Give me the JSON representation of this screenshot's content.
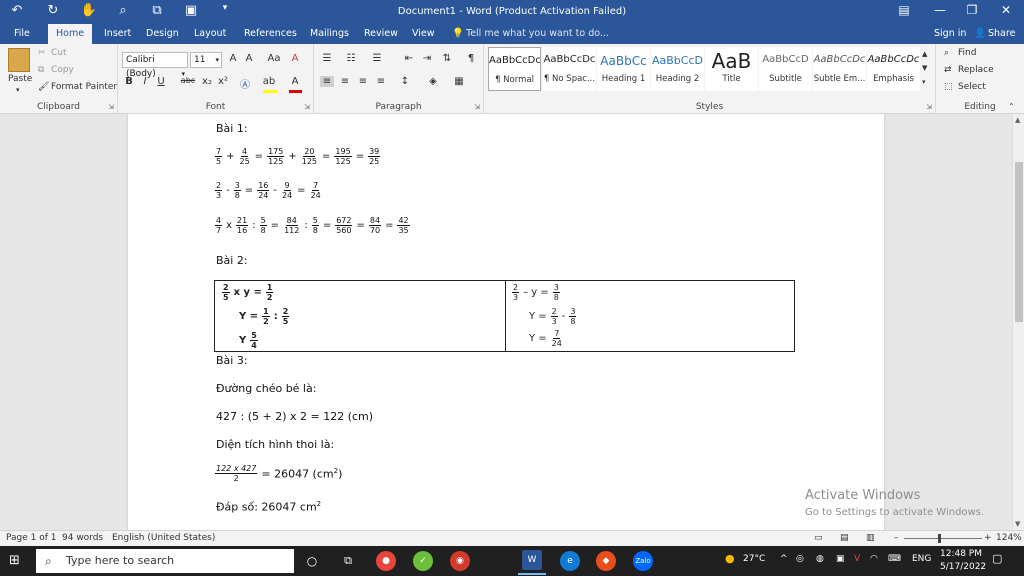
{
  "titlebar": {
    "title": "Document1 - Word (Product Activation Failed)",
    "undo_glyph": "↶",
    "redo_glyph": "↻",
    "save_glyph": "▣",
    "minimize_glyph": "—",
    "restore_glyph": "❐",
    "close_glyph": "✕",
    "ribbon_display_glyph": "▤"
  },
  "tabs": [
    {
      "label": "File"
    },
    {
      "label": "Home"
    },
    {
      "label": "Insert"
    },
    {
      "label": "Design"
    },
    {
      "label": "Layout"
    },
    {
      "label": "References"
    },
    {
      "label": "Mailings"
    },
    {
      "label": "Review"
    },
    {
      "label": "View"
    }
  ],
  "tell_me": "Tell me what you want to do...",
  "signin": "Sign in",
  "share": "Share",
  "clipboard": {
    "paste": "Paste",
    "cut": "Cut",
    "copy": "Copy",
    "format_painter": "Format Painter",
    "label": "Clipboard"
  },
  "font": {
    "name": "Calibri (Body)",
    "size": "11",
    "label": "Font",
    "bold": "B",
    "italic": "I",
    "underline": "U",
    "strike": "abc",
    "subscript": "x₂",
    "superscript": "x²",
    "grow": "A",
    "shrink": "A",
    "case": "Aa",
    "clear": "A"
  },
  "paragraph": {
    "label": "Paragraph",
    "pilcrow": "¶"
  },
  "styles": {
    "label": "Styles",
    "items": [
      {
        "preview": "AaBbCcDc",
        "name": "¶ Normal"
      },
      {
        "preview": "AaBbCcDc",
        "name": "¶ No Spac..."
      },
      {
        "preview": "AaBbCc",
        "name": "Heading 1"
      },
      {
        "preview": "AaBbCcD",
        "name": "Heading 2"
      },
      {
        "preview": "AaB",
        "name": "Title"
      },
      {
        "preview": "AaBbCcD",
        "name": "Subtitle"
      },
      {
        "preview": "AaBbCcDc",
        "name": "Subtle Em..."
      },
      {
        "preview": "AaBbCcDc",
        "name": "Emphasis"
      }
    ]
  },
  "editing": {
    "label": "Editing",
    "find": "Find",
    "replace": "Replace",
    "select": "Select"
  },
  "colors": {
    "accent": "#2b579a",
    "highlight": "#ffff00",
    "font_color": "#e00000"
  },
  "doc": {
    "bai1": "Bài 1:",
    "eq1": {
      "a_n": "7",
      "a_d": "5",
      "op1": "+",
      "b_n": "4",
      "b_d": "25",
      "c_n": "175",
      "c_d": "125",
      "op2": "+",
      "d_n": "20",
      "d_d": "125",
      "e_n": "195",
      "e_d": "125",
      "f_n": "39",
      "f_d": "25"
    },
    "eq2": {
      "a_n": "2",
      "a_d": "3",
      "op1": "-",
      "b_n": "3",
      "b_d": "8",
      "c_n": "16",
      "c_d": "24",
      "op2": "-",
      "d_n": "9",
      "d_d": "24",
      "e_n": "7",
      "e_d": "24"
    },
    "eq3": {
      "a_n": "4",
      "a_d": "7",
      "op1": "x",
      "b_n": "21",
      "b_d": "16",
      "op2": ":",
      "c_n": "5",
      "c_d": "8",
      "d_n": "84",
      "d_d": "112",
      "op3": ":",
      "e_n": "5",
      "e_d": "8",
      "f_n": "672",
      "f_d": "560",
      "g_n": "84",
      "g_d": "70",
      "h_n": "42",
      "h_d": "35"
    },
    "bai2": "Bài 2:",
    "left": {
      "l1": {
        "a_n": "2",
        "a_d": "5",
        "mid": "x y =",
        "b_n": "1",
        "b_d": "2"
      },
      "l2": {
        "pre": "Y =",
        "a_n": "1",
        "a_d": "2",
        "op": ":",
        "b_n": "2",
        "b_d": "5"
      },
      "l3": {
        "pre": "Y",
        "a_n": "5",
        "a_d": "4"
      }
    },
    "right": {
      "r1": {
        "a_n": "2",
        "a_d": "3",
        "mid": "– y =",
        "b_n": "3",
        "b_d": "8"
      },
      "r2": {
        "pre": "Y =",
        "a_n": "2",
        "a_d": "3",
        "op": "-",
        "b_n": "3",
        "b_d": "8"
      },
      "r3": {
        "pre": "Y =",
        "a_n": "7",
        "a_d": "24"
      }
    },
    "bai3": "Bài 3:",
    "duong_cheo": "Đường chéo bé là:",
    "calc1": "427 : (5 + 2) x 2 = 122 (cm)",
    "dien_tich": "Diện tích hình thoi là:",
    "calc2": {
      "num": "122 x 427",
      "den": "2",
      "rest": "= 26047 (cm",
      "sup": "2",
      "close": ")"
    },
    "dap_so": "Đáp số: 26047 cm",
    "dap_so_sup": "2"
  },
  "watermark": {
    "line1": "Activate Windows",
    "line2": "Go to Settings to activate Windows."
  },
  "status": {
    "page": "Page 1 of 1",
    "words": "94 words",
    "lang": "English (United States)",
    "zoom_minus": "–",
    "zoom_plus": "+",
    "zoom": "124%"
  },
  "taskbar": {
    "search": "Type here to search",
    "temp": "27°C",
    "lang": "ENG",
    "time": "12:48 PM",
    "date": "5/17/2022",
    "zalo": "Zalo",
    "word": "W"
  }
}
